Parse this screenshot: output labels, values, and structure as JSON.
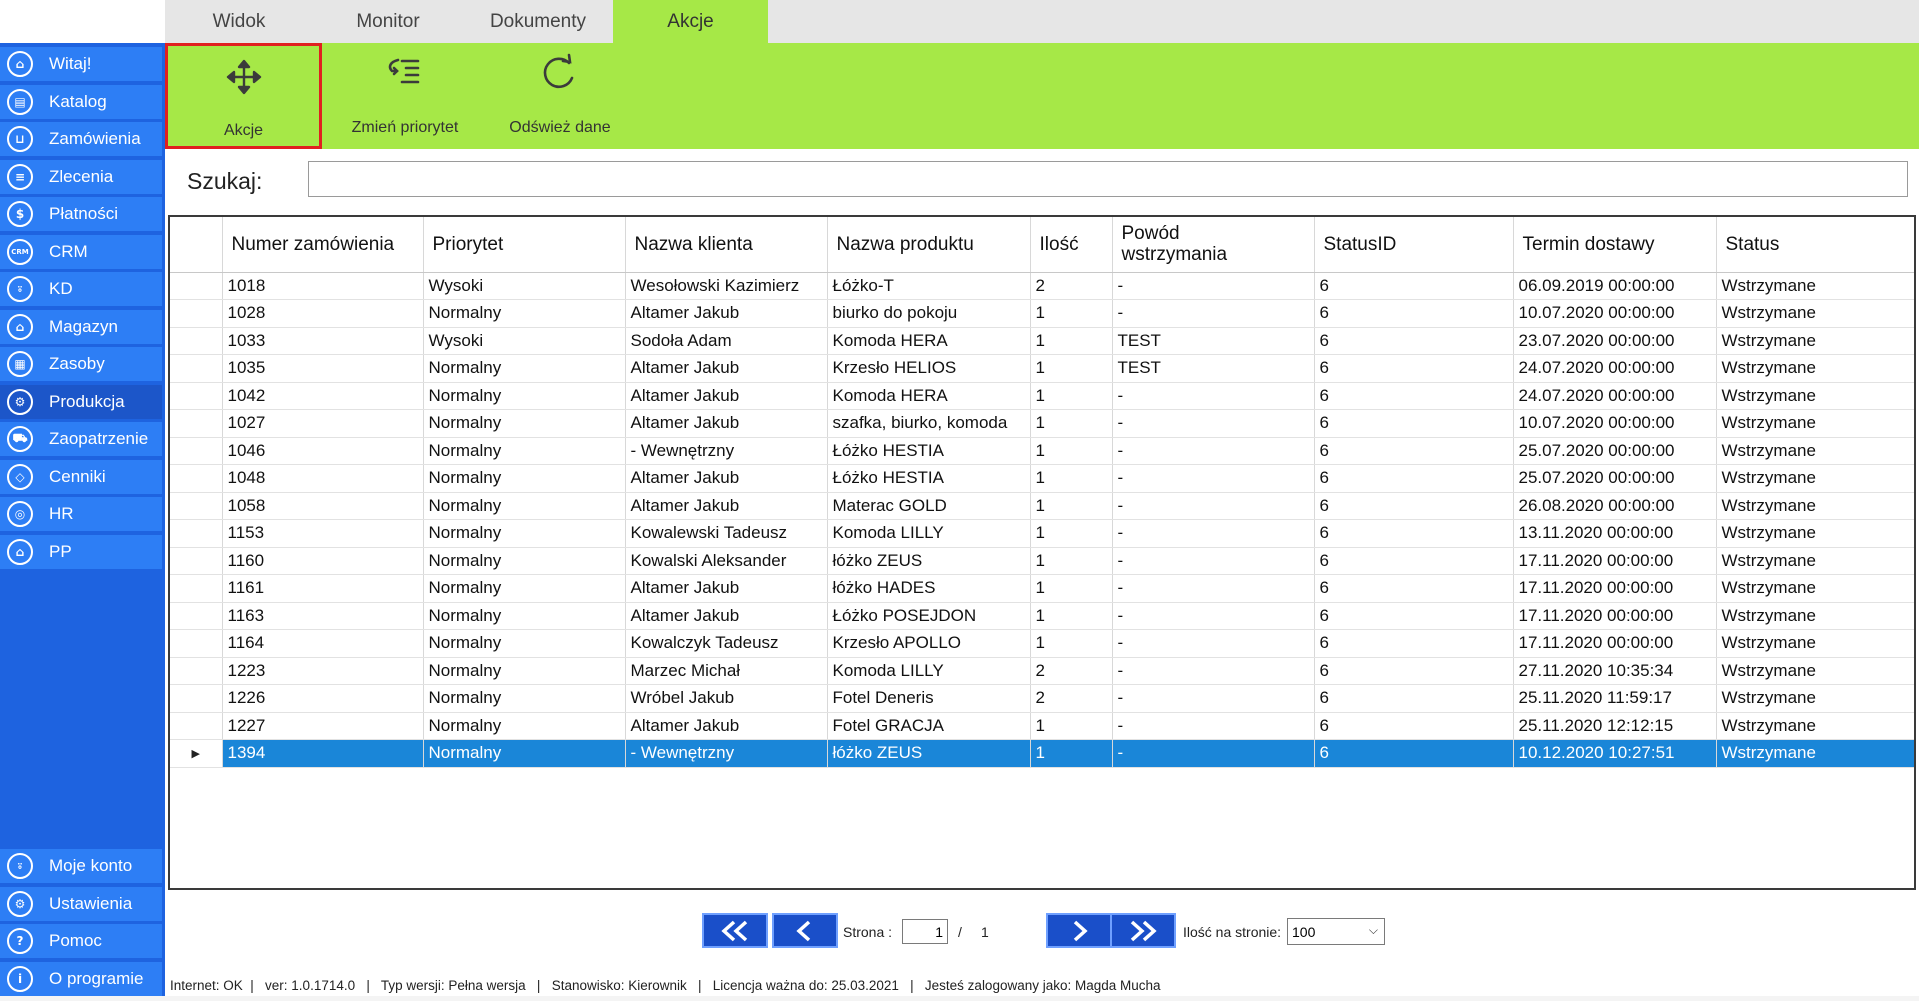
{
  "tabs": [
    {
      "label": "Widok"
    },
    {
      "label": "Monitor"
    },
    {
      "label": "Dokumenty"
    },
    {
      "label": "Akcje",
      "active": true
    }
  ],
  "ribbon": {
    "buttons": [
      {
        "label": "Akcje",
        "icon": "move-arrows-icon",
        "selected": true
      },
      {
        "label": "Zmień priorytet",
        "icon": "priority-list-icon"
      },
      {
        "label": "Odśwież dane",
        "icon": "refresh-icon"
      }
    ]
  },
  "sidebar": {
    "items": [
      {
        "label": "Witaj!",
        "icon": "home-icon"
      },
      {
        "label": "Katalog",
        "icon": "book-icon"
      },
      {
        "label": "Zamówienia",
        "icon": "cart-icon"
      },
      {
        "label": "Zlecenia",
        "icon": "list-icon"
      },
      {
        "label": "Płatności",
        "icon": "dollar-icon"
      },
      {
        "label": "CRM",
        "icon": "crm-icon"
      },
      {
        "label": "KD",
        "icon": "user-icon"
      },
      {
        "label": "Magazyn",
        "icon": "warehouse-icon"
      },
      {
        "label": "Zasoby",
        "icon": "resources-icon"
      },
      {
        "label": "Produkcja",
        "icon": "production-icon",
        "active": true
      },
      {
        "label": "Zaopatrzenie",
        "icon": "truck-icon"
      },
      {
        "label": "Cenniki",
        "icon": "tag-icon"
      },
      {
        "label": "HR",
        "icon": "hr-icon"
      },
      {
        "label": "PP",
        "icon": "pp-icon"
      }
    ],
    "bottom_items": [
      {
        "label": "Moje konto",
        "icon": "account-icon"
      },
      {
        "label": "Ustawienia",
        "icon": "settings-icon"
      },
      {
        "label": "Pomoc",
        "icon": "help-icon"
      },
      {
        "label": "O programie",
        "icon": "info-icon"
      }
    ]
  },
  "search": {
    "label": "Szukaj:",
    "value": ""
  },
  "table": {
    "columns": [
      "Numer zamówienia",
      "Priorytet",
      "Nazwa klienta",
      "Nazwa produktu",
      "Ilość",
      "Powód\nwstrzymania",
      "StatusID",
      "Termin dostawy",
      "Status"
    ],
    "rows": [
      [
        "1018",
        "Wysoki",
        "Wesołowski Kazimierz",
        "Łóżko-T",
        "2",
        "-",
        "6",
        "06.09.2019 00:00:00",
        "Wstrzymane"
      ],
      [
        "1028",
        "Normalny",
        "Altamer Jakub",
        "biurko do pokoju",
        "1",
        "-",
        "6",
        "10.07.2020 00:00:00",
        "Wstrzymane"
      ],
      [
        "1033",
        "Wysoki",
        "Sodoła  Adam",
        "Komoda HERA",
        "1",
        "TEST",
        "6",
        "23.07.2020 00:00:00",
        "Wstrzymane"
      ],
      [
        "1035",
        "Normalny",
        "Altamer Jakub",
        "Krzesło HELIOS",
        "1",
        "TEST",
        "6",
        "24.07.2020 00:00:00",
        "Wstrzymane"
      ],
      [
        "1042",
        "Normalny",
        "Altamer Jakub",
        "Komoda HERA",
        "1",
        "-",
        "6",
        "24.07.2020 00:00:00",
        "Wstrzymane"
      ],
      [
        "1027",
        "Normalny",
        "Altamer Jakub",
        "szafka, biurko, komoda",
        "1",
        "-",
        "6",
        "10.07.2020 00:00:00",
        "Wstrzymane"
      ],
      [
        "1046",
        "Normalny",
        "- Wewnętrzny",
        "Łóżko HESTIA",
        "1",
        "-",
        "6",
        "25.07.2020 00:00:00",
        "Wstrzymane"
      ],
      [
        "1048",
        "Normalny",
        "Altamer Jakub",
        "Łóżko HESTIA",
        "1",
        "-",
        "6",
        "25.07.2020 00:00:00",
        "Wstrzymane"
      ],
      [
        "1058",
        "Normalny",
        "Altamer Jakub",
        "Materac GOLD",
        "1",
        "-",
        "6",
        "26.08.2020 00:00:00",
        "Wstrzymane"
      ],
      [
        "1153",
        "Normalny",
        "Kowalewski Tadeusz",
        "Komoda LILLY",
        "1",
        "-",
        "6",
        "13.11.2020 00:00:00",
        "Wstrzymane"
      ],
      [
        "1160",
        "Normalny",
        "Kowalski Aleksander",
        "łóżko ZEUS",
        "1",
        "-",
        "6",
        "17.11.2020 00:00:00",
        "Wstrzymane"
      ],
      [
        "1161",
        "Normalny",
        "Altamer Jakub",
        "łóżko HADES",
        "1",
        "-",
        "6",
        "17.11.2020 00:00:00",
        "Wstrzymane"
      ],
      [
        "1163",
        "Normalny",
        "Altamer Jakub",
        "Łóżko POSEJDON",
        "1",
        "-",
        "6",
        "17.11.2020 00:00:00",
        "Wstrzymane"
      ],
      [
        "1164",
        "Normalny",
        "Kowalczyk Tadeusz",
        "Krzesło APOLLO",
        "1",
        "-",
        "6",
        "17.11.2020 00:00:00",
        "Wstrzymane"
      ],
      [
        "1223",
        "Normalny",
        "Marzec Michał",
        "Komoda LILLY",
        "2",
        "-",
        "6",
        "27.11.2020 10:35:34",
        "Wstrzymane"
      ],
      [
        "1226",
        "Normalny",
        "Wróbel Jakub",
        "Fotel Deneris",
        "2",
        "-",
        "6",
        "25.11.2020 11:59:17",
        "Wstrzymane"
      ],
      [
        "1227",
        "Normalny",
        "Altamer Jakub",
        "Fotel GRACJA",
        "1",
        "-",
        "6",
        "25.11.2020 12:12:15",
        "Wstrzymane"
      ],
      [
        "1394",
        "Normalny",
        "- Wewnętrzny",
        "łóżko ZEUS",
        "1",
        "-",
        "6",
        "10.12.2020 10:27:51",
        "Wstrzymane"
      ]
    ],
    "selected_row": 17,
    "row_marker": "▶"
  },
  "pagination": {
    "page_label": "Strona :",
    "page_value": "1",
    "separator": "/",
    "total_pages": "1",
    "per_page_label": "Ilość na stronie:",
    "per_page_value": "100"
  },
  "statusbar": {
    "text": "Internet: OK  |   ver: 1.0.1714.0   |   Typ wersji: Pełna wersja   |   Stanowisko: Kierownik   |   Licencja ważna do: 25.03.2021   |   Jesteś zalogowany jako: Magda Mucha"
  },
  "colors": {
    "accent_green": "#a6e847",
    "sidebar_blue": "#2d7ef5",
    "selected_row": "#1a86d8",
    "highlight_border": "#e02020"
  }
}
